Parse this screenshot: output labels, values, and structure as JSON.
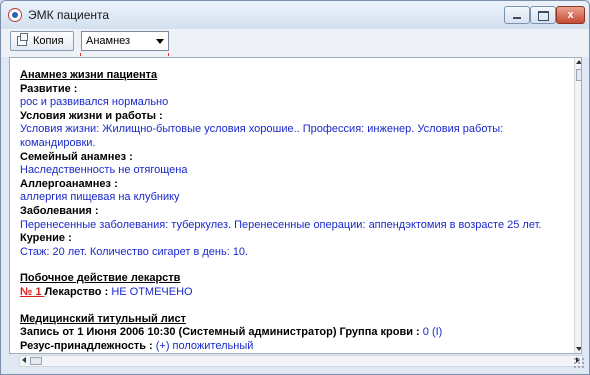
{
  "window": {
    "title": "ЭМК пациента",
    "close_symbol": "x"
  },
  "toolbar": {
    "copy_label": "Копия",
    "section_select": "Анамнез"
  },
  "document": {
    "life_history": {
      "title": "Анамнез жизни пациента",
      "development_label": "Развитие :",
      "development_value": "рос и развивался нормально",
      "conditions_label": "Условия жизни и работы :",
      "conditions_value": "Условия жизни: Жилищно-бытовые условия хорошие.. Профессия: инженер. Условия работы: командировки.",
      "family_label": "Семейный анамнез :",
      "family_value": "Наследственность не отягощена",
      "allergy_label": "Аллергоанамнез :",
      "allergy_value": "аллергия пищевая на клубнику",
      "diseases_label": "Заболевания :",
      "diseases_value": "Перенесенные заболевания: туберкулез. Перенесенные операции: аппендэктомия в возрасте 25 лет.",
      "smoking_label": "Курение :",
      "smoking_value": "Стаж: 20 лет. Количество сигарет в день: 10."
    },
    "side_effects": {
      "title": "Побочное действие лекарств",
      "number": "№ 1 ",
      "drug_label": "Лекарство :",
      "drug_value": "НЕ ОТМЕЧЕНО"
    },
    "title_sheet": {
      "title": "Медицинский титульный лист",
      "record_label": "Запись от 1 Июня 2006 10:30 (Системный администратор) Группа крови :",
      "blood_value": "0 (I)",
      "rh_label": "Резус-принадлежность :",
      "rh_value": "(+) положительный",
      "more": "»"
    }
  }
}
